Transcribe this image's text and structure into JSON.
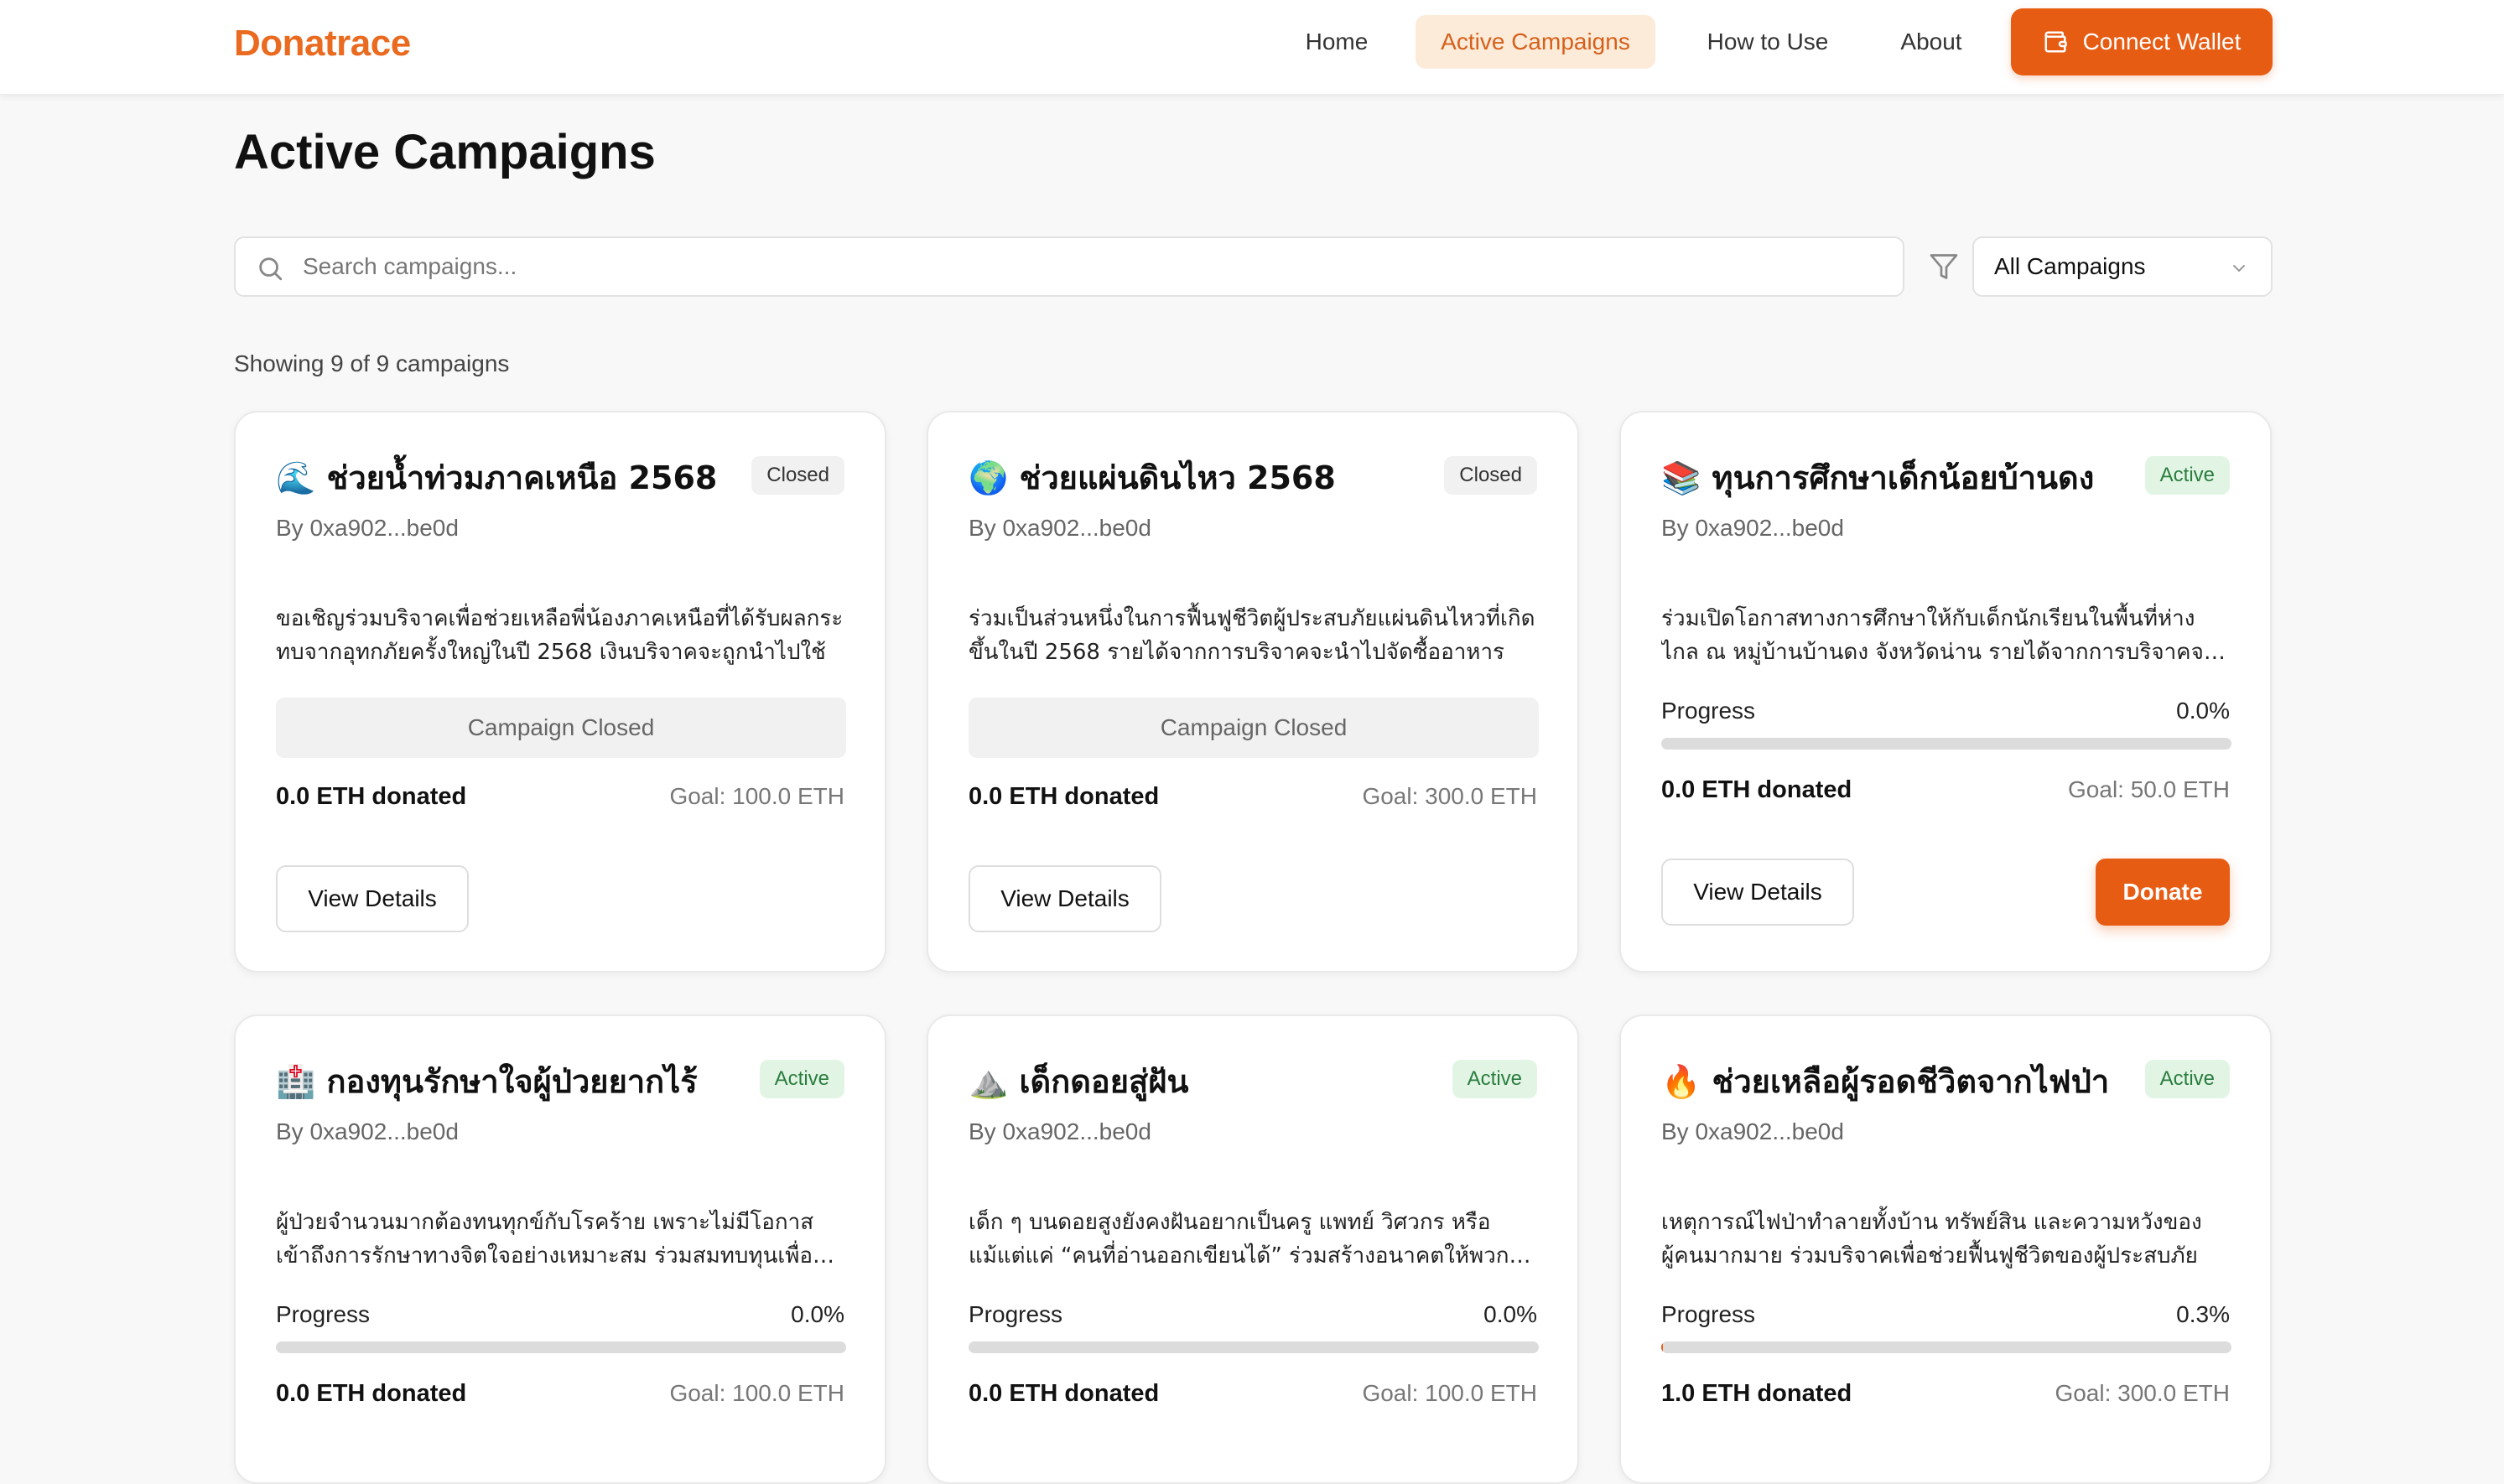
{
  "header": {
    "logo": "Donatrace",
    "nav": [
      {
        "label": "Home"
      },
      {
        "label": "Active Campaigns"
      },
      {
        "label": "How to Use"
      },
      {
        "label": "About"
      }
    ],
    "connect_wallet": "Connect Wallet",
    "icon": "wallet-icon"
  },
  "page": {
    "title": "Active Campaigns",
    "search_placeholder": "Search campaigns...",
    "filter_selected": "All Campaigns",
    "showing": "Showing 9 of 9 campaigns"
  },
  "colors": {
    "accent": "#e75c13",
    "nav_active_bg": "#fdebd9",
    "active_badge_bg": "#e2f5e5",
    "active_badge_text": "#2b7d3e"
  },
  "labels": {
    "progress": "Progress",
    "view_details": "View Details",
    "donate": "Donate",
    "campaign_closed": "Campaign Closed"
  },
  "campaigns": [
    {
      "title": "🌊 ช่วยน้ำท่วมภาคเหนือ 2568",
      "status": "Closed",
      "author": "By 0xa902...be0d",
      "description": "ขอเชิญร่วมบริจาคเพื่อช่วยเหลือพี่น้องภาคเหนือที่ได้รับผลกระทบจากอุทกภัยครั้งใหญ่ในปี 2568 เงินบริจาคจะถูกนำไปใช้",
      "progress_text": "",
      "progress_value": 0,
      "donated": "0.0 ETH donated",
      "goal": "Goal: 100.0 ETH"
    },
    {
      "title": "🌍 ช่วยแผ่นดินไหว 2568",
      "status": "Closed",
      "author": "By 0xa902...be0d",
      "description": "ร่วมเป็นส่วนหนึ่งในการฟื้นฟูชีวิตผู้ประสบภัยแผ่นดินไหวที่เกิดขึ้นในปี 2568 รายได้จากการบริจาคจะนำไปจัดซื้ออาหาร",
      "progress_text": "",
      "progress_value": 0,
      "donated": "0.0 ETH donated",
      "goal": "Goal: 300.0 ETH"
    },
    {
      "title": "📚 ทุนการศึกษาเด็กน้อยบ้านดง",
      "status": "Active",
      "author": "By 0xa902...be0d",
      "description": "ร่วมเปิดโอกาสทางการศึกษาให้กับเด็กนักเรียนในพื้นที่ห่างไกล ณ หมู่บ้านบ้านดง จังหวัดน่าน รายได้จากการบริจาคจะนำไปใช้",
      "progress_text": "0.0%",
      "progress_value": 0.0,
      "donated": "0.0 ETH donated",
      "goal": "Goal: 50.0 ETH"
    },
    {
      "title": "🏥 กองทุนรักษาใจผู้ป่วยยากไร้",
      "status": "Active",
      "author": "By 0xa902...be0d",
      "description": "ผู้ป่วยจำนวนมากต้องทนทุกข์กับโรคร้าย เพราะไม่มีโอกาสเข้าถึงการรักษาทางจิตใจอย่างเหมาะสม ร่วมสมทบทุนเพื่อช่วยเหลือ",
      "progress_text": "0.0%",
      "progress_value": 0.0,
      "donated": "0.0 ETH donated",
      "goal": "Goal: 100.0 ETH"
    },
    {
      "title": "⛰️ เด็กดอยสู่ฝัน",
      "status": "Active",
      "author": "By 0xa902...be0d",
      "description": "เด็ก ๆ บนดอยสูงยังคงฝันอยากเป็นครู แพทย์ วิศวกร หรือแม้แต่แค่ “คนที่อ่านออกเขียนได้” ร่วมสร้างอนาคตให้พวกเขา",
      "progress_text": "0.0%",
      "progress_value": 0.0,
      "donated": "0.0 ETH donated",
      "goal": "Goal: 100.0 ETH"
    },
    {
      "title": "🔥 ช่วยเหลือผู้รอดชีวิตจากไฟป่า",
      "status": "Active",
      "author": "By 0xa902...be0d",
      "description": "เหตุการณ์ไฟป่าทำลายทั้งบ้าน ทรัพย์สิน และความหวังของผู้คนมากมาย ร่วมบริจาคเพื่อช่วยฟื้นฟูชีวิตของผู้ประสบภัย",
      "progress_text": "0.3%",
      "progress_value": 0.3,
      "donated": "1.0 ETH donated",
      "goal": "Goal: 300.0 ETH"
    }
  ]
}
